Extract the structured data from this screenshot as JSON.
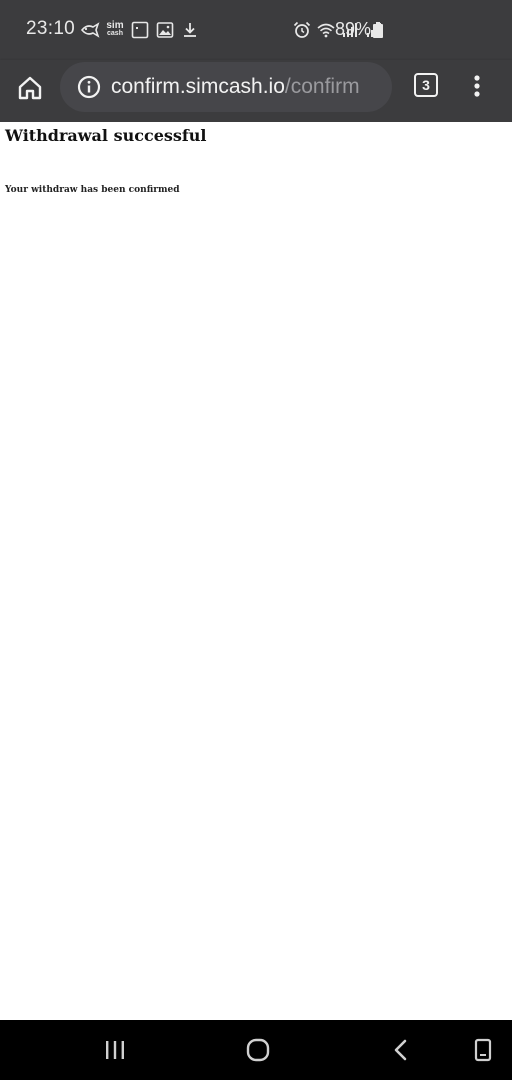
{
  "status_bar": {
    "time": "23:10",
    "sim_app_line1": "sim",
    "sim_app_line2": "cash",
    "battery_percent": "89%"
  },
  "toolbar": {
    "url_domain": "confirm.simcash.io",
    "url_path": "/confirm",
    "tab_count": "3"
  },
  "page": {
    "heading": "Withdrawal successful",
    "message": "Your withdraw has been confirmed"
  },
  "icons": {
    "status_left": [
      "fish-icon",
      "sim-cash-app-icon",
      "square-notification-icon",
      "image-icon",
      "download-icon"
    ],
    "status_right": [
      "alarm-icon",
      "wifi-icon",
      "signal-icon",
      "signal-icon",
      "battery-icon"
    ],
    "toolbar": [
      "home-icon",
      "info-icon",
      "tab-switcher-icon",
      "more-vert-icon"
    ],
    "nav": [
      "recent-apps-icon",
      "home-circle-icon",
      "back-icon",
      "keyboard-toggle-icon"
    ]
  },
  "colors": {
    "chrome_bar": "#3c3c3e",
    "omnibox": "#46464a",
    "url_domain": "#f2f2f2",
    "url_path": "#9a9a9e",
    "nav_bar": "#000000"
  }
}
